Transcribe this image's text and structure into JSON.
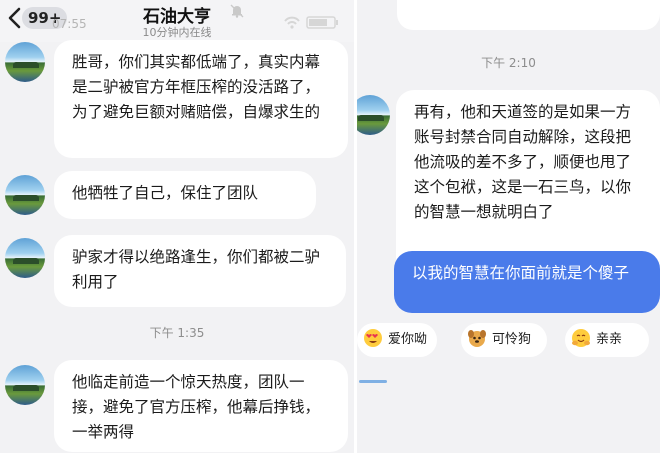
{
  "header": {
    "title": "石油大亨",
    "subtitle": "10分钟内在线",
    "unread_badge": "99+",
    "clock": "07:55"
  },
  "left_panel": {
    "messages": [
      {
        "text": "胜哥，你们其实都低端了，真实内幕是二驴被官方年框压榨的没活路了，为了避免巨额对赌赔偿，自爆求生的"
      },
      {
        "text": "他牺牲了自己，保住了团队"
      },
      {
        "text": "驴家才得以绝路逢生，你们都被二驴利用了"
      },
      {
        "text": "他临走前造一个惊天热度，团队一接，避免了官方压榨，他幕后挣钱，一举两得"
      }
    ],
    "timestamp": "下午 1:35"
  },
  "right_panel": {
    "timestamp": "下午 2:10",
    "received_message": "再有，他和天道签的是如果一方账号封禁合同自动解除，这段把他流吸的差不多了，顺便也甩了这个包袱，这是一石三鸟，以你的智慧一想就明白了",
    "sent_message": "以我的智慧在你面前就是个傻子",
    "quick_replies": [
      {
        "label": "爱你呦",
        "icon": "heart-eyes-emoji-icon"
      },
      {
        "label": "可怜狗",
        "icon": "puppy-face-emoji-icon"
      },
      {
        "label": "亲亲",
        "icon": "hug-emoji-icon"
      }
    ]
  },
  "colors": {
    "background": "#f2f2f4",
    "bubble_received": "#ffffff",
    "bubble_sent": "#4a7bea",
    "timestamp_text": "#8d8d8d"
  }
}
